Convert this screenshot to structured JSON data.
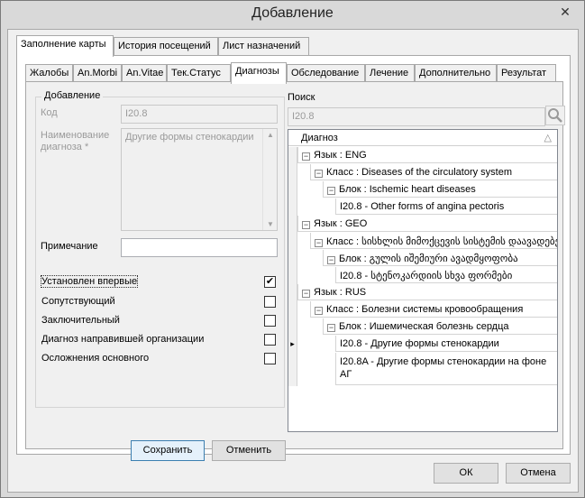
{
  "window": {
    "title": "Добавление",
    "close_glyph": "✕"
  },
  "outer_tabs": [
    {
      "label": "Заполнение карты",
      "active": true
    },
    {
      "label": "История посещений",
      "active": false
    },
    {
      "label": "Лист назначений",
      "active": false
    }
  ],
  "inner_tabs": [
    {
      "label": "Жалобы"
    },
    {
      "label": "An.Morbi"
    },
    {
      "label": "An.Vitae"
    },
    {
      "label": "Тек.Статус"
    },
    {
      "label": "Диагнозы",
      "active": true
    },
    {
      "label": "Обследование"
    },
    {
      "label": "Лечение"
    },
    {
      "label": "Дополнительно"
    },
    {
      "label": "Результат"
    }
  ],
  "form": {
    "group_title": "Добавление",
    "code_label": "Код",
    "code_value": "I20.8",
    "name_label": "Наименование диагноза *",
    "name_value": "Другие формы стенокардии",
    "note_label": "Примечание",
    "note_value": "",
    "checkboxes": [
      {
        "label": "Установлен впервые",
        "checked": true
      },
      {
        "label": "Сопутствующий",
        "checked": false
      },
      {
        "label": "Заключительный",
        "checked": false
      },
      {
        "label": "Диагноз направившей организации",
        "checked": false
      },
      {
        "label": "Осложнения основного",
        "checked": false
      }
    ],
    "save_label": "Сохранить",
    "cancel_label": "Отменить"
  },
  "search": {
    "label": "Поиск",
    "value": "I20.8"
  },
  "tree": {
    "header": "Диагноз",
    "sort_glyph": "△",
    "rows": [
      {
        "text": "Язык : ENG",
        "level": 0,
        "expander": true
      },
      {
        "text": "Класс : Diseases of the circulatory system",
        "level": 1,
        "expander": true
      },
      {
        "text": "Блок : Ischemic heart diseases",
        "level": 2,
        "expander": true
      },
      {
        "text": "I20.8 - Other forms of angina pectoris",
        "level": 3,
        "expander": false
      },
      {
        "text": "Язык : GEO",
        "level": 0,
        "expander": true
      },
      {
        "text": "Класс : სისხლის მიმოქცევის სისტემის დაავადებები",
        "level": 1,
        "expander": true
      },
      {
        "text": "Блок : გულის იშემიური ავადმყოფობა",
        "level": 2,
        "expander": true
      },
      {
        "text": "I20.8 - სტენოკარდიის სხვა ფორმები",
        "level": 3,
        "expander": false
      },
      {
        "text": "Язык : RUS",
        "level": 0,
        "expander": true
      },
      {
        "text": "Класс : Болезни системы кровообращения",
        "level": 1,
        "expander": true
      },
      {
        "text": "Блок : Ишемическая болезнь сердца",
        "level": 2,
        "expander": true
      },
      {
        "text": "I20.8 - Другие формы стенокардии",
        "level": 3,
        "expander": false,
        "current": true
      },
      {
        "text": "I20.8A - Другие формы стенокардии на фоне АГ",
        "level": 3,
        "expander": false,
        "tall": true
      }
    ]
  },
  "footer": {
    "ok_label": "ОК",
    "cancel_label": "Отмена"
  }
}
